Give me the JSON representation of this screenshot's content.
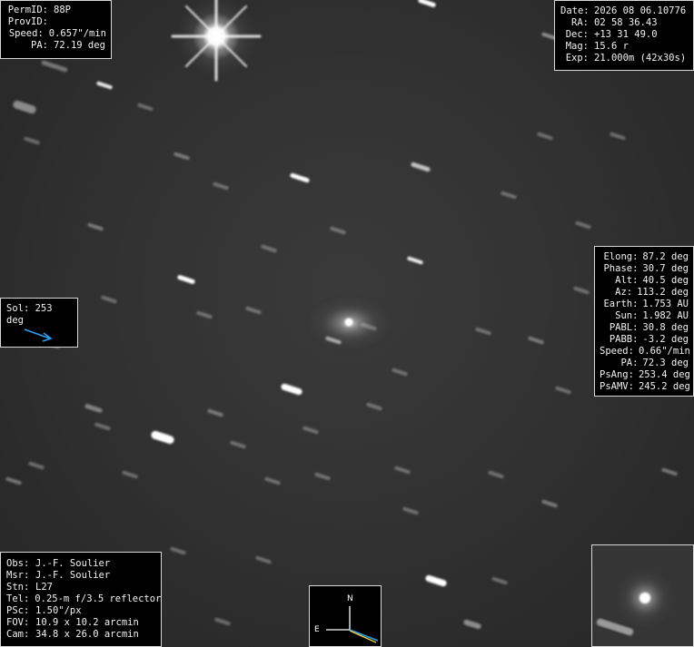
{
  "target_info": {
    "rows": [
      {
        "label": "PermID:",
        "value": "88P"
      },
      {
        "label": "ProvID:",
        "value": ""
      },
      {
        "label": "Speed:",
        "value": "0.657\"/min"
      },
      {
        "label": "PA:",
        "value": "72.19 deg"
      }
    ]
  },
  "observation_info": {
    "rows": [
      {
        "label": "Date:",
        "value": "2026 08 06.10776"
      },
      {
        "label": "RA:",
        "value": "02 58 36.43"
      },
      {
        "label": "Dec:",
        "value": "+13 31 49.0"
      },
      {
        "label": "Mag:",
        "value": "15.6 r"
      },
      {
        "label": "Exp:",
        "value": "21.000m (42x30s)"
      }
    ]
  },
  "geometry_info": {
    "rows": [
      {
        "label": "Elong:",
        "value": "87.2 deg"
      },
      {
        "label": "Phase:",
        "value": "30.7 deg"
      },
      {
        "label": "Alt:",
        "value": "40.5 deg"
      },
      {
        "label": "Az:",
        "value": "113.2 deg"
      },
      {
        "label": "Earth:",
        "value": "1.753 AU"
      },
      {
        "label": "Sun:",
        "value": "1.982 AU"
      },
      {
        "label": "PABL:",
        "value": "30.8 deg"
      },
      {
        "label": "PABB:",
        "value": "-3.2 deg"
      },
      {
        "label": "Speed:",
        "value": "0.66\"/min"
      },
      {
        "label": "PA:",
        "value": "72.3 deg"
      },
      {
        "label": "PsAng:",
        "value": "253.4 deg"
      },
      {
        "label": "PsAMV:",
        "value": "245.2 deg"
      }
    ]
  },
  "sun_direction": {
    "label": "Sol: 253 deg",
    "arrow_color": "#2a9df4",
    "icon": "sun-direction-arrow-icon"
  },
  "observer_info": {
    "rows": [
      {
        "label": "Obs:",
        "value": "J.-F. Soulier"
      },
      {
        "label": "Msr:",
        "value": "J.-F. Soulier"
      },
      {
        "label": "Stn:",
        "value": "L27"
      },
      {
        "label": "Tel:",
        "value": "0.25-m f/3.5 reflector"
      },
      {
        "label": "PSc:",
        "value": "1.50\"/px"
      },
      {
        "label": "FOV:",
        "value": "10.9 x 10.2 arcmin"
      },
      {
        "label": "Cam:",
        "value": "34.8 x 26.0 arcmin"
      }
    ]
  },
  "compass": {
    "north_label": "N",
    "east_label": "E",
    "motion_color": "#2a9df4",
    "sun_color": "#e8d23a",
    "icon": "compass-rose-icon"
  },
  "image": {
    "subject": "comet",
    "background_color": "#333333",
    "star_color": "#ffffff"
  }
}
